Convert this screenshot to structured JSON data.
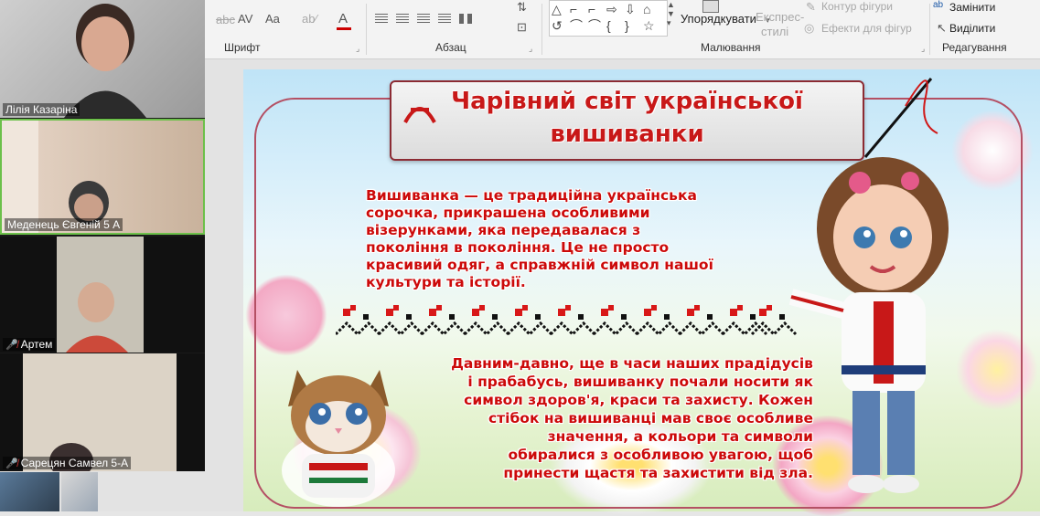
{
  "ribbon": {
    "groups": {
      "font": "Шрифт",
      "paragraph": "Абзац",
      "drawing": "Малювання",
      "editing": "Редагування"
    },
    "arrange_label": "Упорядкувати",
    "quick_styles_line1": "Експрес-",
    "quick_styles_line2": "стилі",
    "shape_outline": "Контур фігури",
    "shape_effects": "Ефекти для фігур",
    "replace": "Замінити",
    "select": "Виділити",
    "font_buttons": [
      "abc",
      "AV",
      "Aa",
      "A"
    ],
    "shape_glyphs": [
      "△",
      "⌐",
      "⌐",
      "⇨",
      "⇩",
      "⌂",
      "↺",
      "⌒",
      "⌒",
      "{",
      "}",
      "☆"
    ]
  },
  "slide": {
    "title_line1": "Чарівний світ української",
    "title_line2": "вишиванки",
    "paragraph1": [
      "Вишиванка — це традиційна українська",
      "сорочка, прикрашена особливими",
      "візерунками, яка передавалася з",
      "покоління в покоління. Це не просто",
      "красивий одяг, а справжній символ нашої",
      "культури та історії."
    ],
    "paragraph2": [
      "Давним-давно, ще в часи наших прадідусів",
      "і прабабусь, вишиванку почали носити як",
      "символ здоров'я, краси та захисту. Кожен",
      "стібок на вишиванці мав своє особливе",
      "значення, а кольори та символи",
      "обиралися з особливою увагою, щоб",
      "принести щастя та захистити від зла."
    ]
  },
  "participants": [
    {
      "name": "Лілія Казаріна",
      "muted": false
    },
    {
      "name": "Меденець Євгеній 5 А",
      "muted": false
    },
    {
      "name": "Артем",
      "muted": true
    },
    {
      "name": "Сарецян Самвел 5-А",
      "muted": true
    }
  ],
  "colors": {
    "accent_red": "#cc0a0a",
    "ribbon_bg": "#f3f3f3",
    "frame": "#b45064"
  }
}
